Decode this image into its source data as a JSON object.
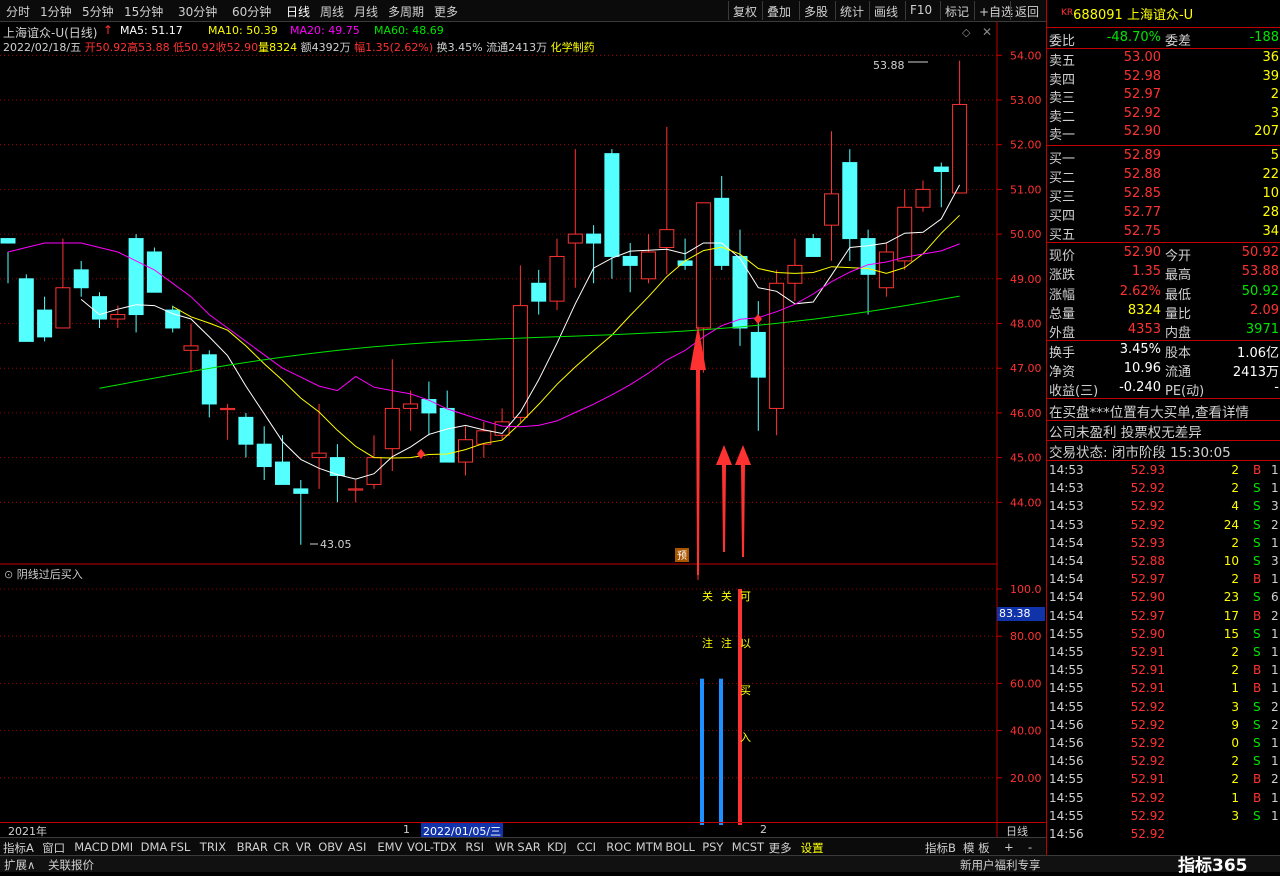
{
  "toolbar": {
    "tabs": [
      "分时",
      "1分钟",
      "5分钟",
      "15分钟",
      "30分钟",
      "60分钟",
      "日线",
      "周线",
      "月线",
      "多周期",
      "更多"
    ],
    "right": [
      "复权",
      "叠加",
      "多股",
      "统计",
      "画线",
      "F10",
      "标记",
      "+自选",
      "返回"
    ]
  },
  "stock": {
    "name_line": "上海谊众-U(日线)",
    "ma5": "MA5: 51.17",
    "ma10": "MA10: 50.39",
    "ma20": "MA20: 49.75",
    "ma60": "MA60: 48.69",
    "date": "2022/02/18/五",
    "open": "开50.92",
    "high": "高53.88",
    "low": "低50.92",
    "close": "收52.90",
    "vol": "量8324",
    "amt": "额4392万",
    "chg": "幅1.35(2.62%)",
    "turn": "换3.45%",
    "float": "流通2413万",
    "sector": "化学制药"
  },
  "colors": {
    "up": "#ff3232",
    "down": "#54ffff",
    "ma5": "#ffffff",
    "ma10": "#ffff00",
    "ma20": "#ff00ff",
    "ma60": "#00e600",
    "arrow": "#ff3232",
    "grid": "#c00000"
  },
  "price_axis": [
    "54.00",
    "53.00",
    "52.00",
    "51.00",
    "50.00",
    "49.00",
    "48.00",
    "47.00",
    "46.00",
    "45.00",
    "44.00"
  ],
  "annot": {
    "high": "53.88",
    "low": "43.05",
    "pre": "预"
  },
  "sub": {
    "title": "阴线过后买入",
    "axis": [
      "100.0",
      "80.00",
      "60.00",
      "40.00",
      "20.00"
    ],
    "cur": "83.38",
    "col1": [
      "关",
      "注"
    ],
    "col2": [
      "关",
      "注"
    ],
    "col3": [
      "可",
      "以",
      "买",
      "入"
    ]
  },
  "datebar": {
    "year": "2021年",
    "m1": "1",
    "sel": "2022/01/05/三",
    "m2": "2",
    "right": "日线"
  },
  "indicators": [
    "指标A",
    "窗口",
    "MACD",
    "DMI",
    "DMA",
    "FSL",
    "TRIX",
    "BRAR",
    "CR",
    "VR",
    "OBV",
    "ASI",
    "EMV",
    "VOL-TDX",
    "RSI",
    "WR",
    "SAR",
    "KDJ",
    "CCI",
    "ROC",
    "MTM",
    "BOLL",
    "PSY",
    "MCST",
    "更多",
    "设置",
    "指标B",
    "模 板",
    "+",
    "-"
  ],
  "bottom": {
    "expand": "扩展∧",
    "linked": "关联报价",
    "newuser": "新用户福利专享",
    "logo": "指标365"
  },
  "chart_data": {
    "type": "candlestick",
    "series": [
      "MA5",
      "MA10",
      "MA20",
      "MA60"
    ],
    "ohlc": [
      [
        49.9,
        49.6,
        48.9,
        49.8
      ],
      [
        49.0,
        49.1,
        47.8,
        47.6
      ],
      [
        48.3,
        48.6,
        47.6,
        47.7
      ],
      [
        47.9,
        49.9,
        47.9,
        48.8
      ],
      [
        49.2,
        49.4,
        48.6,
        48.8
      ],
      [
        48.6,
        48.7,
        47.9,
        48.1
      ],
      [
        48.1,
        48.4,
        47.9,
        48.2
      ],
      [
        49.9,
        50.0,
        47.8,
        48.2
      ],
      [
        49.6,
        49.7,
        48.7,
        48.7
      ],
      [
        48.3,
        48.4,
        47.8,
        47.9
      ],
      [
        47.4,
        48.0,
        46.9,
        47.5
      ],
      [
        47.3,
        47.4,
        45.9,
        46.2
      ],
      [
        46.1,
        46.2,
        45.4,
        46.1
      ],
      [
        45.9,
        46.0,
        45.0,
        45.3
      ],
      [
        45.3,
        45.7,
        44.5,
        44.8
      ],
      [
        44.9,
        45.5,
        44.6,
        44.4
      ],
      [
        44.3,
        44.5,
        43.05,
        44.2
      ],
      [
        45.0,
        46.2,
        44.3,
        45.1
      ],
      [
        45.0,
        45.3,
        44.0,
        44.6
      ],
      [
        44.3,
        44.5,
        44.0,
        44.3
      ],
      [
        44.4,
        45.5,
        44.3,
        45.0
      ],
      [
        45.2,
        47.2,
        44.7,
        46.1
      ],
      [
        46.1,
        46.5,
        45.6,
        46.2
      ],
      [
        46.3,
        46.7,
        45.5,
        46.0
      ],
      [
        46.1,
        46.5,
        44.9,
        44.9
      ],
      [
        44.9,
        45.7,
        44.6,
        45.4
      ],
      [
        45.3,
        45.8,
        45.0,
        45.6
      ],
      [
        45.5,
        46.1,
        45.4,
        45.8
      ],
      [
        45.9,
        49.3,
        45.8,
        48.4
      ],
      [
        48.9,
        49.2,
        48.2,
        48.5
      ],
      [
        48.5,
        49.9,
        48.3,
        49.5
      ],
      [
        49.8,
        51.9,
        48.8,
        50.0
      ],
      [
        50.0,
        50.2,
        48.9,
        49.8
      ],
      [
        51.8,
        51.9,
        49.0,
        49.5
      ],
      [
        49.5,
        49.8,
        48.7,
        49.3
      ],
      [
        49.0,
        50.0,
        48.9,
        49.6
      ],
      [
        49.7,
        52.4,
        49.1,
        50.1
      ],
      [
        49.4,
        49.9,
        49.2,
        49.3
      ],
      [
        47.9,
        49.4,
        46.9,
        50.7
      ],
      [
        50.8,
        51.3,
        49.2,
        49.3
      ],
      [
        49.5,
        50.1,
        47.5,
        47.9
      ],
      [
        47.8,
        48.5,
        45.6,
        46.8
      ],
      [
        46.1,
        49.2,
        45.5,
        48.9
      ],
      [
        48.9,
        49.9,
        48.5,
        49.3
      ],
      [
        49.9,
        50.0,
        49.5,
        49.5
      ],
      [
        50.2,
        52.3,
        49.4,
        50.9
      ],
      [
        51.6,
        51.9,
        49.4,
        49.9
      ],
      [
        49.9,
        50.1,
        48.2,
        49.1
      ],
      [
        48.8,
        49.8,
        48.6,
        49.6
      ],
      [
        49.4,
        51.0,
        49.2,
        50.6
      ],
      [
        50.6,
        51.2,
        50.5,
        51.0
      ],
      [
        51.5,
        51.6,
        50.6,
        51.4
      ],
      [
        50.92,
        53.88,
        50.92,
        52.9
      ]
    ]
  },
  "rp": {
    "code_prefix": "KR",
    "code": "688091",
    "name": "上海谊众-U",
    "weibi": {
      "label": "委比",
      "val": "-48.70%",
      "label2": "委差",
      "val2": "-188"
    },
    "sell": [
      [
        "卖五",
        "53.00",
        "36"
      ],
      [
        "卖四",
        "52.98",
        "39"
      ],
      [
        "卖三",
        "52.97",
        "2"
      ],
      [
        "卖二",
        "52.92",
        "3"
      ],
      [
        "卖一",
        "52.90",
        "207"
      ]
    ],
    "buy": [
      [
        "买一",
        "52.89",
        "5"
      ],
      [
        "买二",
        "52.88",
        "22"
      ],
      [
        "买三",
        "52.85",
        "10"
      ],
      [
        "买四",
        "52.77",
        "28"
      ],
      [
        "买五",
        "52.75",
        "34"
      ]
    ],
    "quote": [
      [
        "现价",
        "52.90",
        "今开",
        "50.92"
      ],
      [
        "涨跌",
        "1.35",
        "最高",
        "53.88"
      ],
      [
        "涨幅",
        "2.62%",
        "最低",
        "50.92"
      ],
      [
        "总量",
        "8324",
        "量比",
        "2.09"
      ],
      [
        "外盘",
        "4353",
        "内盘",
        "3971"
      ]
    ],
    "fin": [
      [
        "换手",
        "3.45%",
        "股本",
        "1.06亿"
      ],
      [
        "净资",
        "10.96",
        "流通",
        "2413万"
      ],
      [
        "收益(三)",
        "-0.240",
        "PE(动)",
        "-"
      ]
    ],
    "notice1": "在买盘***位置有大买单,查看详情",
    "notice2": "公司未盈利 投票权无差异",
    "status": "交易状态: 闭市阶段 15:30:05",
    "trades": [
      [
        "14:53",
        "52.93",
        "2",
        "B",
        "1"
      ],
      [
        "14:53",
        "52.92",
        "2",
        "S",
        "1"
      ],
      [
        "14:53",
        "52.92",
        "4",
        "S",
        "3"
      ],
      [
        "14:53",
        "52.92",
        "24",
        "S",
        "2"
      ],
      [
        "14:54",
        "52.93",
        "2",
        "S",
        "1"
      ],
      [
        "14:54",
        "52.88",
        "10",
        "S",
        "3"
      ],
      [
        "14:54",
        "52.97",
        "2",
        "B",
        "1"
      ],
      [
        "14:54",
        "52.90",
        "23",
        "S",
        "6"
      ],
      [
        "14:54",
        "52.97",
        "17",
        "B",
        "2"
      ],
      [
        "14:55",
        "52.90",
        "15",
        "S",
        "1"
      ],
      [
        "14:55",
        "52.91",
        "2",
        "S",
        "1"
      ],
      [
        "14:55",
        "52.91",
        "2",
        "B",
        "1"
      ],
      [
        "14:55",
        "52.91",
        "1",
        "B",
        "1"
      ],
      [
        "14:55",
        "52.92",
        "3",
        "S",
        "2"
      ],
      [
        "14:56",
        "52.92",
        "9",
        "S",
        "2"
      ],
      [
        "14:56",
        "52.92",
        "0",
        "S",
        "1"
      ],
      [
        "14:56",
        "52.92",
        "2",
        "S",
        "1"
      ],
      [
        "14:55",
        "52.91",
        "2",
        "B",
        "2"
      ],
      [
        "14:55",
        "52.92",
        "1",
        "B",
        "1"
      ],
      [
        "14:55",
        "52.92",
        "3",
        "S",
        "1"
      ],
      [
        "14:56",
        "52.92",
        "",
        "",
        ""
      ]
    ]
  }
}
